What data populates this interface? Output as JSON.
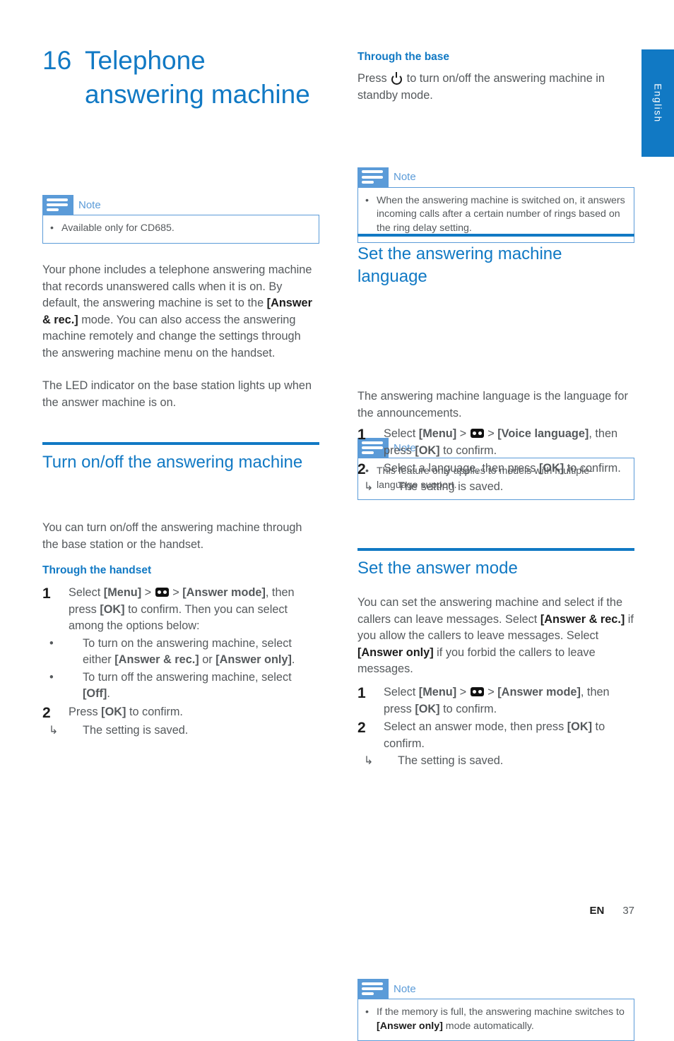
{
  "page": {
    "language_tab": "English",
    "footer": {
      "language_code": "EN",
      "page_number": "37"
    },
    "accent_color": "#1179c4",
    "note_color": "#5b9bd8"
  },
  "chapter": {
    "number": "16",
    "title": "Telephone answering machine"
  },
  "left_column": {
    "note_top": {
      "label": "Note",
      "items": [
        "Available only for CD685."
      ]
    },
    "intro_p1_a": "Your phone includes a telephone answering machine that records unanswered calls when it is on. By default, the answering machine is set to the ",
    "intro_p1_bold": "[Answer & rec.]",
    "intro_p1_b": " mode. You can also access the answering machine remotely and change the settings through the answering machine menu on the handset.",
    "intro_p2": "The LED indicator on the base station lights up when the answer machine is on.",
    "section_turn_onoff": {
      "heading": "Turn on/off the answering machine",
      "intro": "You can turn on/off the answering machine through the base station or the handset.",
      "subheading": "Through the handset",
      "step1": {
        "number": "1",
        "text_a": "Select ",
        "menu": "[Menu]",
        "gt1": " > ",
        "icon": "cassette-icon",
        "gt2": " > ",
        "answer_mode": "[Answer mode]",
        "text_b": ", then press ",
        "ok": "[OK]",
        "text_c": " to confirm. Then you can select among the options below:",
        "bullets": [
          {
            "bullet": "•",
            "text_a": "To turn on the answering machine, select either ",
            "bold_a": "[Answer & rec.]",
            "text_b": " or ",
            "bold_b": "[Answer only]",
            "text_c": "."
          },
          {
            "bullet": "•",
            "text_a": "To turn off the answering machine, select ",
            "bold_a": "[Off]",
            "text_b": "."
          }
        ]
      },
      "step2": {
        "number": "2",
        "text_a": "Press ",
        "ok": "[OK]",
        "text_b": " to confirm.",
        "result_arrow": "↳",
        "result": "The setting is saved."
      }
    }
  },
  "right_column": {
    "subheading_base": "Through the base",
    "base_text_a": "Press ",
    "base_icon": "power-icon",
    "base_text_b": " to turn on/off the answering machine in standby mode.",
    "note_base": {
      "label": "Note",
      "items": [
        "When the answering machine is switched on, it answers incoming calls after a certain number of rings based on the ring delay setting."
      ]
    },
    "section_language": {
      "heading": "Set the answering machine language",
      "note": {
        "label": "Note",
        "items": [
          "This feature only applies to models with multiple-language support."
        ]
      },
      "intro": "The answering machine language is the language for the announcements.",
      "step1": {
        "number": "1",
        "text_a": "Select ",
        "menu": "[Menu]",
        "gt1": " > ",
        "icon": "cassette-icon",
        "gt2": " > ",
        "target": "[Voice language]",
        "text_b": ", then press ",
        "ok": "[OK]",
        "text_c": " to confirm."
      },
      "step2": {
        "number": "2",
        "text_a": "Select a language, then press ",
        "ok": "[OK]",
        "text_b": " to confirm.",
        "result_arrow": "↳",
        "result": "The setting is saved."
      }
    },
    "section_answer_mode": {
      "heading": "Set the answer mode",
      "intro_a": "You can set the answering machine and select if the callers can leave messages. Select ",
      "intro_bold_a": "[Answer & rec.]",
      "intro_b": " if you allow the callers to leave messages. Select ",
      "intro_bold_b": "[Answer only]",
      "intro_c": " if you forbid the callers to leave messages.",
      "step1": {
        "number": "1",
        "text_a": "Select ",
        "menu": "[Menu]",
        "gt1": " > ",
        "icon": "cassette-icon",
        "gt2": " > ",
        "target": "[Answer mode]",
        "text_b": ", then press ",
        "ok": "[OK]",
        "text_c": " to confirm."
      },
      "step2": {
        "number": "2",
        "text_a": "Select an answer mode, then press ",
        "ok": "[OK]",
        "text_b": " to confirm.",
        "result_arrow": "↳",
        "result": "The setting is saved."
      },
      "note": {
        "label": "Note",
        "items_parts": {
          "text_a": "If the memory is full, the answering machine switches to ",
          "bold": "[Answer only]",
          "text_b": " mode automatically."
        }
      }
    }
  }
}
